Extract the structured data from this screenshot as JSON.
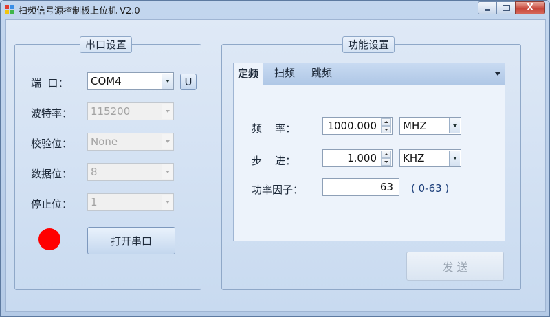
{
  "window": {
    "title": "扫频信号源控制板上位机 V2.0",
    "caption_buttons": [
      "minimize",
      "maximize",
      "close"
    ],
    "close_glyph": "X"
  },
  "serial": {
    "group_title": "串口设置",
    "port_label": "端  口：",
    "port_value": "COM4",
    "refresh_button": "U",
    "baud_label": "波特率：",
    "baud_value": "115200",
    "parity_label": "校验位：",
    "parity_value": "None",
    "databits_label": "数据位：",
    "databits_value": "8",
    "stopbits_label": "停止位：",
    "stopbits_value": "1",
    "status_led_color": "#ff0000",
    "open_button": "打开串口"
  },
  "function": {
    "group_title": "功能设置",
    "tabs": [
      {
        "label": "定频",
        "active": true
      },
      {
        "label": "扫频",
        "active": false
      },
      {
        "label": "跳频",
        "active": false
      }
    ],
    "freq_label": "频    率：",
    "freq_value": "1000.000",
    "freq_unit": "MHZ",
    "step_label": "步    进：",
    "step_value": "1.000",
    "step_unit": "KHZ",
    "power_label": "功率因子：",
    "power_value": "63",
    "power_range": "( 0-63 )",
    "send_button": "发  送"
  }
}
